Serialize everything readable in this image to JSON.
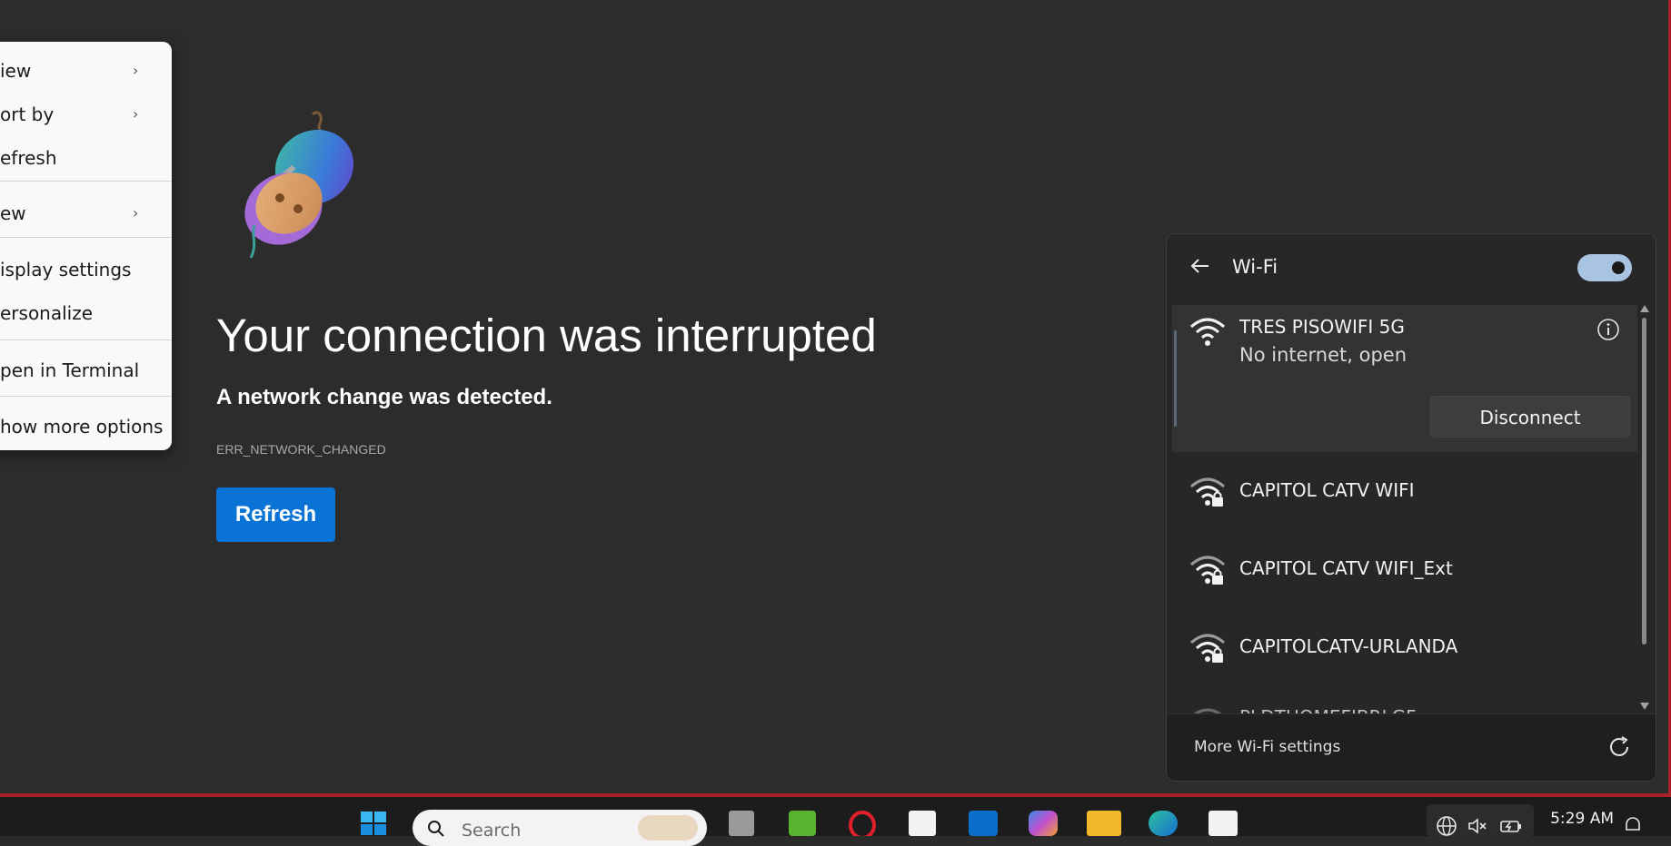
{
  "context_menu": {
    "items": [
      {
        "label": "iew"
      },
      {
        "label": "ort by"
      },
      {
        "label": "efresh"
      },
      {
        "label": "ew"
      },
      {
        "label": "isplay settings"
      },
      {
        "label": "ersonalize"
      },
      {
        "label": "pen in Terminal"
      },
      {
        "label": "how more options"
      }
    ]
  },
  "error_page": {
    "title": "Your connection was interrupted",
    "subtitle": "A network change was detected.",
    "error_code": "ERR_NETWORK_CHANGED",
    "refresh_label": "Refresh"
  },
  "wifi_panel": {
    "title": "Wi-Fi",
    "toggle_on": true,
    "connected": {
      "name": "TRES PISOWIFI 5G",
      "status": "No internet, open",
      "disconnect_label": "Disconnect"
    },
    "networks": [
      {
        "name": "CAPITOL CATV WIFI",
        "secured": true
      },
      {
        "name": "CAPITOL CATV WIFI_Ext",
        "secured": true
      },
      {
        "name": "CAPITOLCATV-URLANDA",
        "secured": true
      },
      {
        "name": "PLDTHOMEFIBRLGF",
        "secured": true
      }
    ],
    "more_settings_label": "More Wi-Fi settings"
  },
  "taskbar": {
    "search_placeholder": "Search",
    "clock_time": "5:29 AM",
    "accent": "#0a73d6"
  },
  "colors": {
    "frame_border": "#a8202a",
    "toggle_on": "#a9c4e2"
  }
}
